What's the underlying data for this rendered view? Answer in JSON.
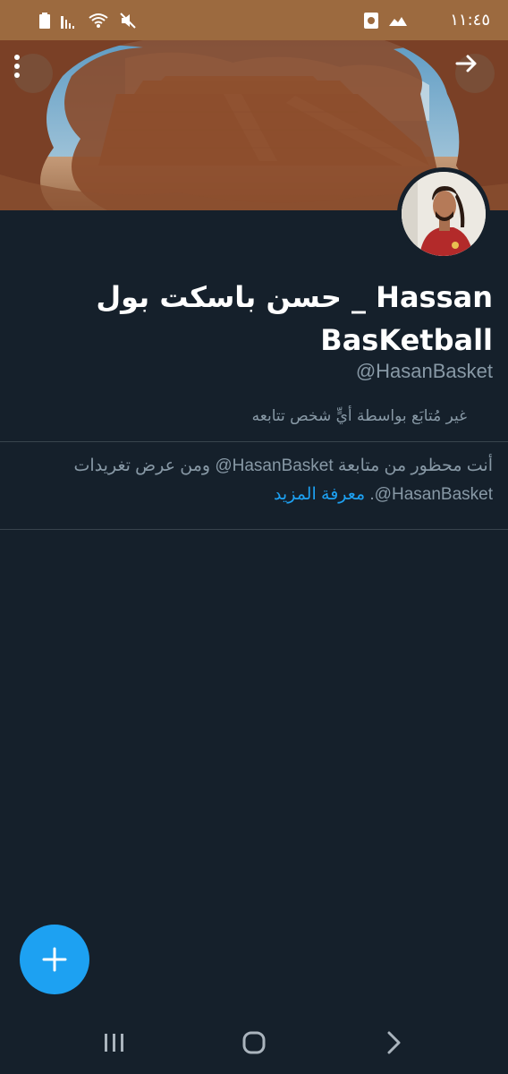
{
  "status_bar": {
    "time": "١١:٤٥"
  },
  "profile": {
    "name": "حسن باسكت بول _ Hassan BasKetball",
    "handle": "@HasanBasket",
    "follow_status": "غير مُتابَع بواسطة أيٍّ شخص تتابعه"
  },
  "blocked_notice": {
    "text": "أنت محظور من متابعة HasanBasket@ ومن عرض تغريدات HasanBasket@.",
    "learn_more": "معرفة المزيد"
  },
  "colors": {
    "background": "#15202b",
    "accent": "#1da1f2",
    "secondary_text": "#8899a6",
    "status_bar": "#9c6a3f"
  },
  "icons": {
    "menu": "more-vertical-icon",
    "back": "arrow-left-icon",
    "compose": "plus-icon",
    "nav_recents": "recents-icon",
    "nav_home": "home-icon",
    "nav_back": "nav-back-icon"
  }
}
